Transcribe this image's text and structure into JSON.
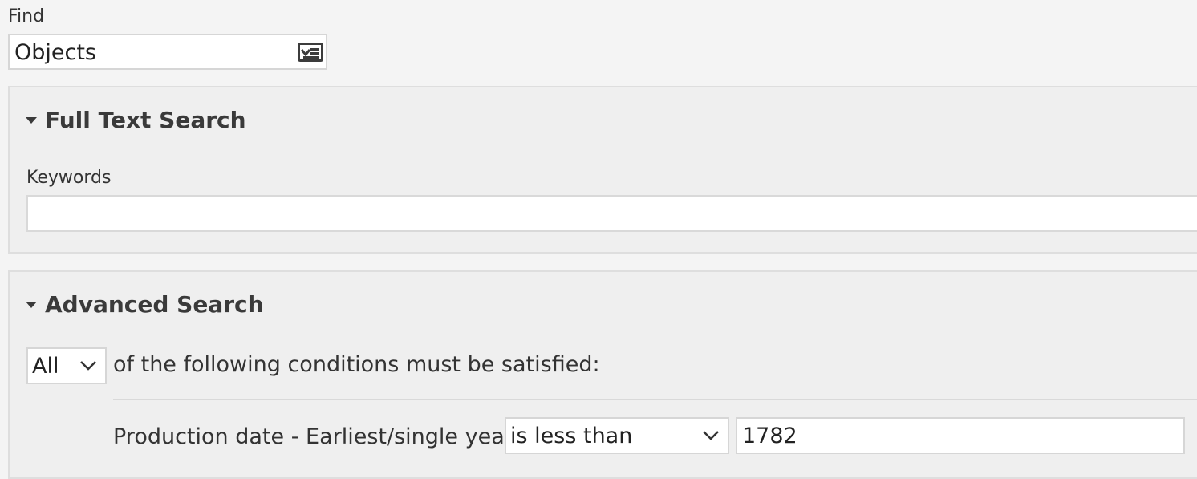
{
  "find": {
    "label": "Find",
    "record_type_value": "Objects",
    "record_type_icon": "dropdown-list-icon"
  },
  "full_text_search": {
    "title": "Full Text Search",
    "keywords_label": "Keywords",
    "keywords_value": ""
  },
  "advanced_search": {
    "title": "Advanced Search",
    "boolean_operator": "All",
    "conditions_text": "of the following conditions must be satisfied:",
    "conditions": [
      {
        "field_label": "Production date - Earliest/single year",
        "comparator": "is less than",
        "value": "1782"
      }
    ]
  }
}
